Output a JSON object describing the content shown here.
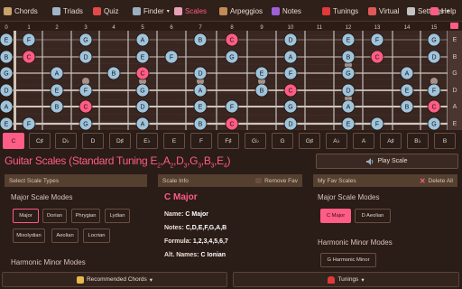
{
  "nav": {
    "items": [
      {
        "label": "Chords",
        "icon": "guitar-icon",
        "icon_color": "#c9a36a",
        "active": false
      },
      {
        "label": "Triads",
        "icon": "notes-icon",
        "icon_color": "#9fb6c8",
        "active": false
      },
      {
        "label": "Quiz",
        "icon": "number-100-icon",
        "icon_color": "#e24a4a",
        "active": false
      },
      {
        "label": "Finder",
        "icon": "magnifier-icon",
        "icon_color": "#9ab0c0",
        "active": false,
        "caret": "▾"
      },
      {
        "label": "Scales",
        "icon": "music-note-icon",
        "icon_color": "#e8a0b8",
        "active": true
      },
      {
        "label": "Arpeggios",
        "icon": "violin-icon",
        "icon_color": "#c28a55",
        "active": false
      },
      {
        "label": "Notes",
        "icon": "purple-circle-icon",
        "icon_color": "#a060d8",
        "active": false
      },
      {
        "label": "Tunings",
        "icon": "magnet-icon",
        "icon_color": "#e03a3a",
        "active": false
      },
      {
        "label": "Virtual",
        "icon": "guitar-icon",
        "icon_color": "#e05858",
        "active": false
      },
      {
        "label": "Settings",
        "icon": "gear-icon",
        "icon_color": "#c2c2c2",
        "active": false,
        "caret": "▾"
      },
      {
        "label": "Help",
        "icon": "question-icon",
        "icon_color": "#ff5c86",
        "active": false
      }
    ]
  },
  "fretboard": {
    "frets": [
      "0",
      "1",
      "2",
      "3",
      "4",
      "5",
      "6",
      "7",
      "8",
      "9",
      "10",
      "11",
      "12",
      "13",
      "14",
      "15"
    ],
    "strings": [
      "E",
      "B",
      "G",
      "D",
      "A",
      "E"
    ],
    "notes": [
      {
        "s": 0,
        "f": 0,
        "n": "E"
      },
      {
        "s": 0,
        "f": 1,
        "n": "F"
      },
      {
        "s": 0,
        "f": 3,
        "n": "G"
      },
      {
        "s": 0,
        "f": 5,
        "n": "A"
      },
      {
        "s": 0,
        "f": 7,
        "n": "B"
      },
      {
        "s": 0,
        "f": 8,
        "n": "C",
        "root": true
      },
      {
        "s": 0,
        "f": 10,
        "n": "D"
      },
      {
        "s": 0,
        "f": 12,
        "n": "E"
      },
      {
        "s": 0,
        "f": 13,
        "n": "F"
      },
      {
        "s": 0,
        "f": 15,
        "n": "G"
      },
      {
        "s": 1,
        "f": 0,
        "n": "B"
      },
      {
        "s": 1,
        "f": 1,
        "n": "C",
        "root": true
      },
      {
        "s": 1,
        "f": 3,
        "n": "D"
      },
      {
        "s": 1,
        "f": 5,
        "n": "E"
      },
      {
        "s": 1,
        "f": 6,
        "n": "F"
      },
      {
        "s": 1,
        "f": 8,
        "n": "G"
      },
      {
        "s": 1,
        "f": 10,
        "n": "A"
      },
      {
        "s": 1,
        "f": 12,
        "n": "B"
      },
      {
        "s": 1,
        "f": 13,
        "n": "C",
        "root": true
      },
      {
        "s": 1,
        "f": 15,
        "n": "D"
      },
      {
        "s": 2,
        "f": 0,
        "n": "G"
      },
      {
        "s": 2,
        "f": 2,
        "n": "A"
      },
      {
        "s": 2,
        "f": 4,
        "n": "B"
      },
      {
        "s": 2,
        "f": 5,
        "n": "C",
        "root": true
      },
      {
        "s": 2,
        "f": 7,
        "n": "D"
      },
      {
        "s": 2,
        "f": 9,
        "n": "E"
      },
      {
        "s": 2,
        "f": 10,
        "n": "F"
      },
      {
        "s": 2,
        "f": 12,
        "n": "G"
      },
      {
        "s": 2,
        "f": 14,
        "n": "A"
      },
      {
        "s": 3,
        "f": 0,
        "n": "D"
      },
      {
        "s": 3,
        "f": 2,
        "n": "E"
      },
      {
        "s": 3,
        "f": 3,
        "n": "F"
      },
      {
        "s": 3,
        "f": 5,
        "n": "G"
      },
      {
        "s": 3,
        "f": 7,
        "n": "A"
      },
      {
        "s": 3,
        "f": 9,
        "n": "B"
      },
      {
        "s": 3,
        "f": 10,
        "n": "C",
        "root": true
      },
      {
        "s": 3,
        "f": 12,
        "n": "D"
      },
      {
        "s": 3,
        "f": 14,
        "n": "E"
      },
      {
        "s": 3,
        "f": 15,
        "n": "F"
      },
      {
        "s": 4,
        "f": 0,
        "n": "A"
      },
      {
        "s": 4,
        "f": 2,
        "n": "B"
      },
      {
        "s": 4,
        "f": 3,
        "n": "C",
        "root": true
      },
      {
        "s": 4,
        "f": 5,
        "n": "D"
      },
      {
        "s": 4,
        "f": 7,
        "n": "E"
      },
      {
        "s": 4,
        "f": 8,
        "n": "F"
      },
      {
        "s": 4,
        "f": 10,
        "n": "G"
      },
      {
        "s": 4,
        "f": 12,
        "n": "A"
      },
      {
        "s": 4,
        "f": 14,
        "n": "B"
      },
      {
        "s": 4,
        "f": 15,
        "n": "C",
        "root": true
      },
      {
        "s": 5,
        "f": 0,
        "n": "E"
      },
      {
        "s": 5,
        "f": 1,
        "n": "F"
      },
      {
        "s": 5,
        "f": 3,
        "n": "G"
      },
      {
        "s": 5,
        "f": 5,
        "n": "A"
      },
      {
        "s": 5,
        "f": 7,
        "n": "B"
      },
      {
        "s": 5,
        "f": 8,
        "n": "C",
        "root": true
      },
      {
        "s": 5,
        "f": 10,
        "n": "D"
      },
      {
        "s": 5,
        "f": 12,
        "n": "E"
      },
      {
        "s": 5,
        "f": 13,
        "n": "F"
      },
      {
        "s": 5,
        "f": 15,
        "n": "G"
      }
    ],
    "colors": {
      "note": "#9fc4dc",
      "root": "#ff5c86",
      "wood": "#3a2620"
    }
  },
  "keys": {
    "items": [
      "C",
      "C♯",
      "D♭",
      "D",
      "D♯",
      "E♭",
      "E",
      "F",
      "F♯",
      "G♭",
      "G",
      "G♯",
      "A♭",
      "A",
      "A♯",
      "B♭",
      "B"
    ],
    "selected": "C"
  },
  "title": {
    "main": "Guitar Scales (Standard Tuning E",
    "sub1": "2",
    "t1": ",A",
    "sub2": "2",
    "t2": ",D",
    "sub3": "3",
    "t3": ",G",
    "sub4": "3",
    "t4": ",B",
    "sub5": "3",
    "t5": ",E",
    "sub6": "4",
    "t6": ")"
  },
  "play_button": {
    "label": "Play Scale",
    "icon": "speaker-icon"
  },
  "panels": {
    "types": {
      "header": "Select Scale Types",
      "major_title": "Major Scale Modes",
      "major_modes": [
        "Major",
        "Dorian",
        "Phrygian",
        "Lydian",
        "Mixolydian",
        "Aeolian",
        "Locrian"
      ],
      "selected": "Major",
      "harmonic_title": "Harmonic Minor Modes"
    },
    "info": {
      "header": "Scale Info",
      "remove_label": "Remove Fav",
      "name": "C Major",
      "name_label": "Name:",
      "name_value": "C Major",
      "notes_label": "Notes:",
      "notes_value": "C,D,E,F,G,A,B",
      "formula_label": "Formula:",
      "formula_value": "1,2,3,4,5,6,7",
      "alt_label": "Alt. Names:",
      "alt_value": "C Ionian"
    },
    "favs": {
      "header": "My Fav Scales",
      "delete_label": "Delete All",
      "major_title": "Major Scale Modes",
      "major_items": [
        "C Major",
        "D Aeolian"
      ],
      "harmonic_title": "Harmonic Minor Modes",
      "harmonic_items": [
        "G Harmonic Minor"
      ]
    }
  },
  "bottom": {
    "chords_label": "Recommended Chords",
    "chords_caret": "▾",
    "tunings_label": "Tunings",
    "tunings_caret": "▾"
  }
}
